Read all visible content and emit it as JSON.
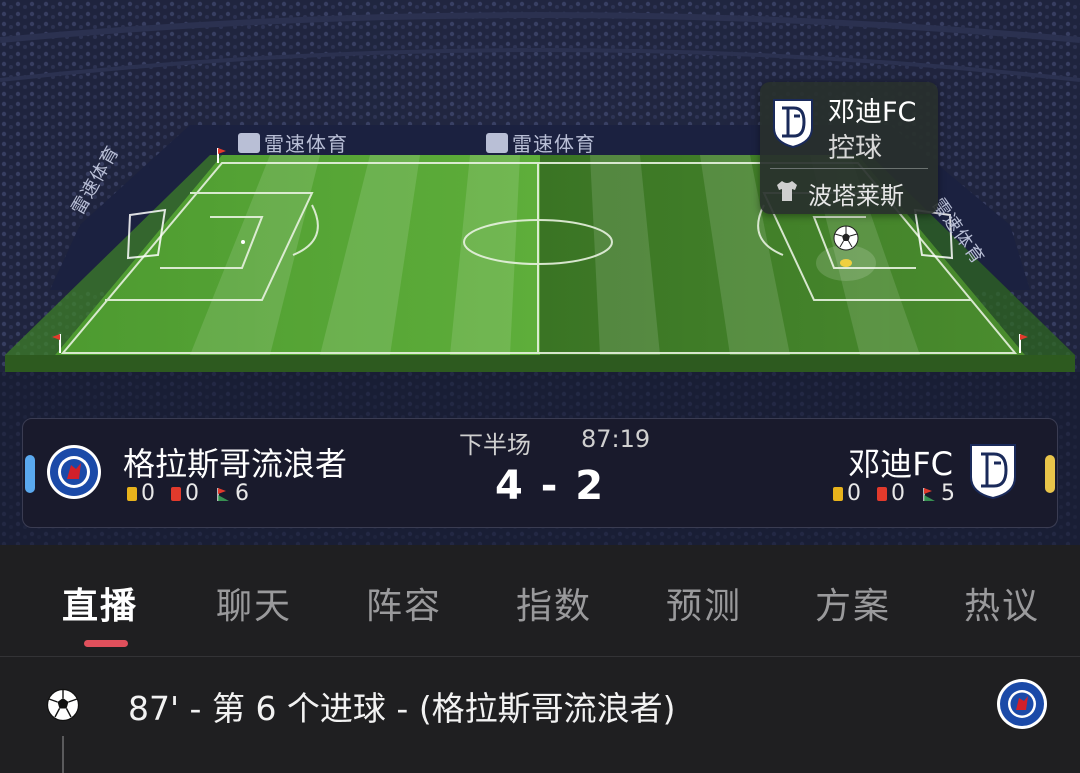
{
  "banner": {
    "sponsor": "雷速体育",
    "sponsor_side": "雷速体育"
  },
  "possession": {
    "team": "邓迪FC",
    "state": "控球",
    "player": "波塔莱斯",
    "team_color": "#ffffff"
  },
  "match": {
    "period": "下半场",
    "clock": "87:19",
    "score": "4 - 2",
    "home": {
      "name": "格拉斯哥流浪者",
      "yellow": "0",
      "red": "0",
      "corners": "6",
      "color": "#5aa9ef"
    },
    "away": {
      "name": "邓迪FC",
      "yellow": "0",
      "red": "0",
      "corners": "5",
      "color": "#e9c54a"
    }
  },
  "tabs": [
    {
      "label": "直播",
      "active": true
    },
    {
      "label": "聊天"
    },
    {
      "label": "阵容"
    },
    {
      "label": "指数"
    },
    {
      "label": "预测"
    },
    {
      "label": "方案"
    },
    {
      "label": "热议"
    }
  ],
  "events": [
    {
      "icon": "soccer-ball-icon",
      "text": "87' - 第 6 个进球 - (格拉斯哥流浪者)",
      "team_icon": "rangers-crest-icon"
    }
  ],
  "colors": {
    "accent": "#e0505c",
    "pitch_light": "#5aa437",
    "pitch_dark": "#3e7d27"
  }
}
